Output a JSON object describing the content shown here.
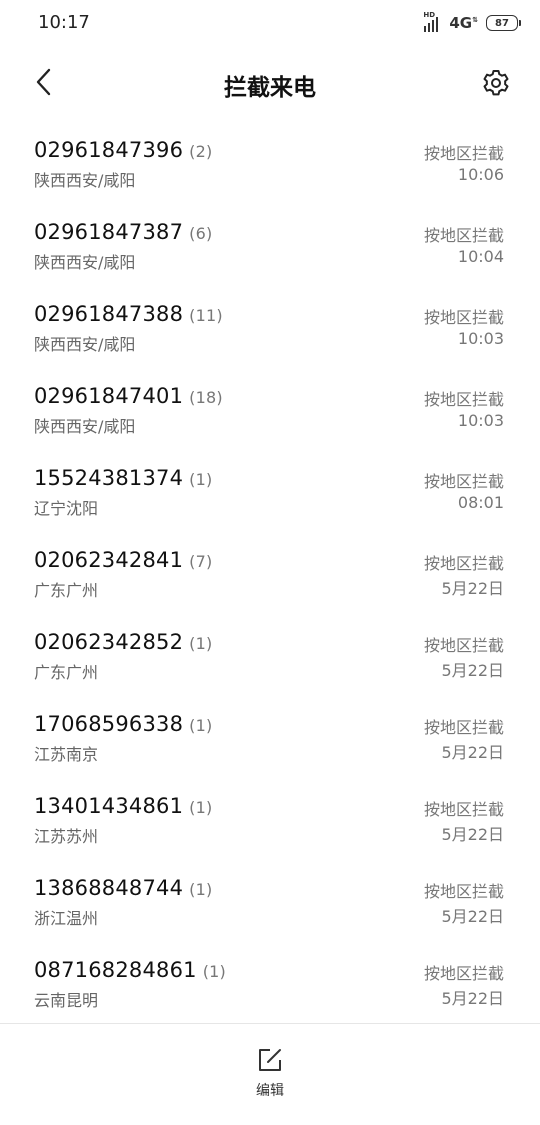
{
  "status_bar": {
    "time": "10:17",
    "hd_label": "HD",
    "network": "4G",
    "battery": "87"
  },
  "header": {
    "title": "拦截来电",
    "back_icon": "chevron-left-icon",
    "settings_icon": "gear-icon"
  },
  "calls": [
    {
      "number": "02961847396",
      "count": "(2)",
      "location": "陕西西安/咸阳",
      "reason": "按地区拦截",
      "time": "10:06"
    },
    {
      "number": "02961847387",
      "count": "(6)",
      "location": "陕西西安/咸阳",
      "reason": "按地区拦截",
      "time": "10:04"
    },
    {
      "number": "02961847388",
      "count": "(11)",
      "location": "陕西西安/咸阳",
      "reason": "按地区拦截",
      "time": "10:03"
    },
    {
      "number": "02961847401",
      "count": "(18)",
      "location": "陕西西安/咸阳",
      "reason": "按地区拦截",
      "time": "10:03"
    },
    {
      "number": "15524381374",
      "count": "(1)",
      "location": "辽宁沈阳",
      "reason": "按地区拦截",
      "time": "08:01"
    },
    {
      "number": "02062342841",
      "count": "(7)",
      "location": "广东广州",
      "reason": "按地区拦截",
      "time": "5月22日"
    },
    {
      "number": "02062342852",
      "count": "(1)",
      "location": "广东广州",
      "reason": "按地区拦截",
      "time": "5月22日"
    },
    {
      "number": "17068596338",
      "count": "(1)",
      "location": "江苏南京",
      "reason": "按地区拦截",
      "time": "5月22日"
    },
    {
      "number": "13401434861",
      "count": "(1)",
      "location": "江苏苏州",
      "reason": "按地区拦截",
      "time": "5月22日"
    },
    {
      "number": "13868848744",
      "count": "(1)",
      "location": "浙江温州",
      "reason": "按地区拦截",
      "time": "5月22日"
    },
    {
      "number": "087168284861",
      "count": "(1)",
      "location": "云南昆明",
      "reason": "按地区拦截",
      "time": "5月22日"
    }
  ],
  "bottom_bar": {
    "edit_label": "编辑",
    "edit_icon": "edit-icon"
  }
}
